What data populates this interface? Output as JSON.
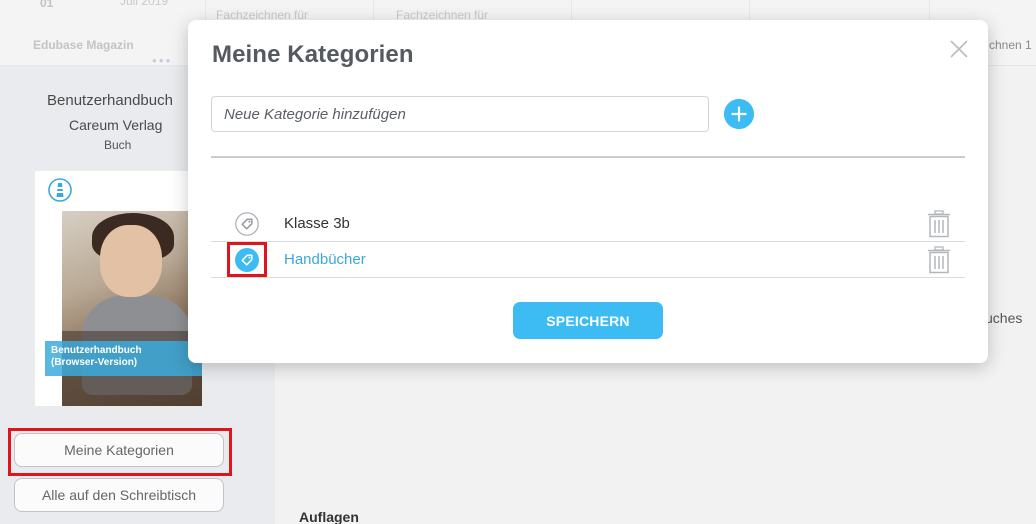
{
  "background": {
    "top_strip": {
      "cells": [
        {
          "text": "01",
          "style": "strong"
        },
        {
          "text": "Juli 2019"
        },
        {
          "text": "Edubase Magazin"
        },
        {
          "text": "Fachzeichnen für"
        },
        {
          "text": "Fachzeichnen für"
        },
        {
          "text": "chnen 1"
        }
      ]
    },
    "sidebar": {
      "book_title": "Benutzerhandbuch",
      "publisher": "Careum Verlag",
      "type": "Buch",
      "cover_banner_line1": "Benutzerhandbuch",
      "cover_banner_line2": "(Browser-Version)",
      "buttons": {
        "categories": "Meine Kategorien",
        "desk": "Alle auf den Schreibtisch"
      }
    },
    "content": {
      "partial_text": "uches",
      "auflagen_heading": "Auflagen"
    }
  },
  "modal": {
    "title": "Meine Kategorien",
    "new_category_placeholder": "Neue Kategorie hinzufügen",
    "categories": [
      {
        "label": "Klasse 3b",
        "selected": false
      },
      {
        "label": "Handbücher",
        "selected": true
      }
    ],
    "save_label": "SPEICHERN"
  },
  "colors": {
    "accent": "#3cbcf3",
    "selected_text": "#3aa8e0",
    "highlight": "#e0141b"
  },
  "icons": {
    "close": "close-icon",
    "add": "plus-circle-icon",
    "tag": "tag-icon",
    "trash": "trash-icon"
  }
}
